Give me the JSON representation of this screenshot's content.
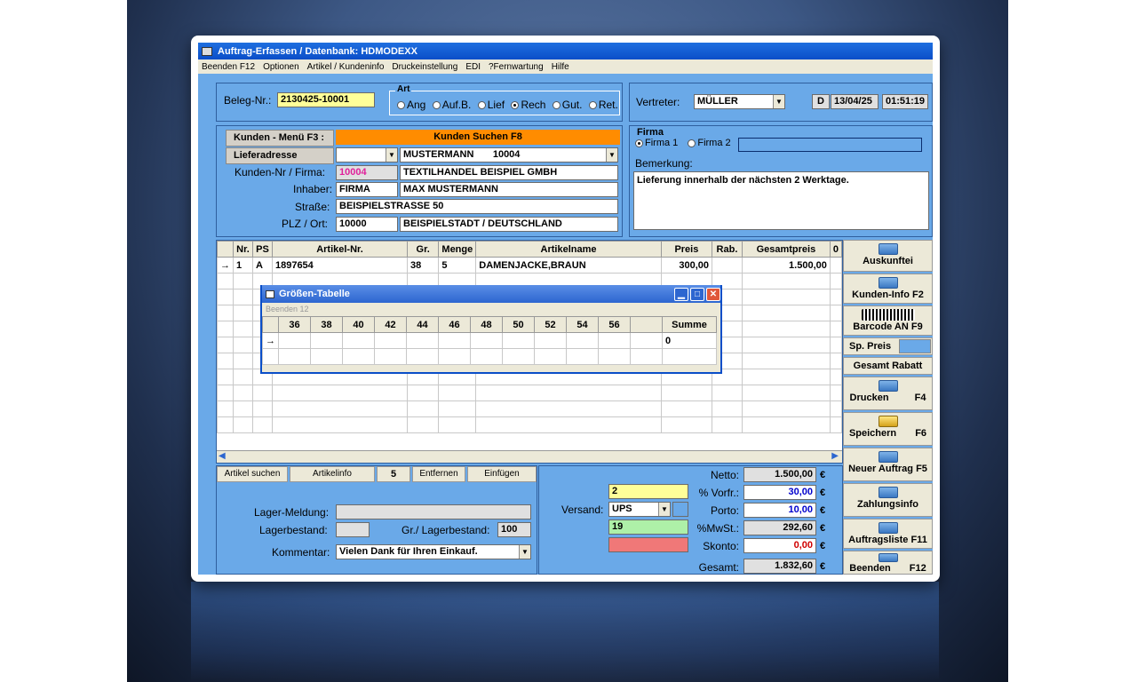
{
  "window": {
    "title": "Auftrag-Erfassen / Datenbank: HDMODEXX",
    "menu": [
      "Beenden F12",
      "Optionen",
      "Artikel / Kundeninfo",
      "Druckeinstellung",
      "EDI",
      "?Fernwartung",
      "Hilfe"
    ]
  },
  "header": {
    "beleg_label": "Beleg-Nr.:",
    "beleg_value": "2130425-10001",
    "art_label": "Art",
    "art_options": [
      "Ang",
      "Auf.B.",
      "Lief",
      "Rech",
      "Gut.",
      "Ret."
    ],
    "art_selected": "Rech",
    "vertreter_label": "Vertreter:",
    "vertreter_value": "MÜLLER",
    "d_button": "D",
    "date": "13/04/25",
    "time": "01:51:19"
  },
  "customer": {
    "menu_label": "Kunden - Menü  F3 :",
    "search_label": "Kunden Suchen      F8",
    "lieferadresse_label": "Lieferadresse",
    "customer_select": "MUSTERMANN       10004",
    "kundennr_label": "Kunden-Nr / Firma:",
    "kundennr_value": "10004",
    "firma_value": "TEXTILHANDEL BEISPIEL GMBH",
    "inhaber_label": "Inhaber:",
    "inhaber_value1": "FIRMA",
    "inhaber_value2": "MAX MUSTERMANN",
    "strasse_label": "Straße:",
    "strasse_value": "BEISPIELSTRASSE 50",
    "plz_label": "PLZ / Ort:",
    "plz_value": "10000",
    "ort_value": "BEISPIELSTADT / DEUTSCHLAND"
  },
  "firma": {
    "label": "Firma",
    "option1": "Firma 1",
    "option2": "Firma 2",
    "bemerkung_label": "Bemerkung:",
    "bemerkung_value": "Lieferung innerhalb der nächsten 2 Werktage."
  },
  "grid": {
    "columns": [
      "Nr.",
      "PS",
      "Artikel-Nr.",
      "Gr.",
      "Menge",
      "Artikelname",
      "Preis",
      "Rab.",
      "Gesamtpreis",
      "0"
    ],
    "rows": [
      [
        "1",
        "A",
        "1897654",
        "38",
        "5",
        "DAMENJACKE,BRAUN",
        "300,00",
        "",
        "1.500,00",
        ""
      ]
    ],
    "row_marker": "→"
  },
  "popup": {
    "title": "Größen-Tabelle",
    "menu": "Beenden 12",
    "columns": [
      "36",
      "38",
      "40",
      "42",
      "44",
      "46",
      "48",
      "50",
      "52",
      "54",
      "56",
      "",
      "Summe"
    ],
    "sum_value": "0",
    "row_marker": "→"
  },
  "side_buttons": {
    "auskunft": "Auskunftei",
    "kundeninfo": "Kunden-Info F2",
    "barcode": "Barcode AN F9",
    "sp_preis": "Sp. Preis",
    "gesamt_rabatt": "Gesamt Rabatt",
    "drucken": "Drucken",
    "drucken_key": "F4",
    "speichern": "Speichern",
    "speichern_key": "F6",
    "neuer_auftrag": "Neuer Auftrag F5",
    "zahlungsinfo": "Zahlungsinfo",
    "auftragsliste": "Auftragsliste F11",
    "beenden": "Beenden",
    "beenden_key": "F12"
  },
  "bottom_tabs": [
    "Artikel suchen",
    "Artikelinfo",
    "5",
    "Entfernen",
    "Einfügen"
  ],
  "stock": {
    "lager_meldung_label": "Lager-Meldung:",
    "lagerbestand_label": "Lagerbestand:",
    "gr_lagerbestand_label": "Gr./ Lagerbestand:",
    "gr_lagerbestand_value": "100",
    "kommentar_label": "Kommentar:",
    "kommentar_value": "Vielen Dank für Ihren Einkauf."
  },
  "totals": {
    "versand_label": "Versand:",
    "versand_value": "UPS",
    "vorfr_value": "2",
    "mwst_value": "19",
    "netto_label": "Netto:",
    "netto": "1.500,00",
    "vorfr_label": "% Vorfr.:",
    "vorfr": "30,00",
    "porto_label": "Porto:",
    "porto": "10,00",
    "mwst_label": "%MwSt.:",
    "mwst": "292,60",
    "skonto_label": "Skonto:",
    "skonto": "0,00",
    "gesamt_label": "Gesamt:",
    "gesamt": "1.832,60",
    "currency": "€"
  },
  "colors": {
    "title_blue": "#0a4ec8",
    "panel_blue": "#6aa9e8",
    "orange": "#ff8c00",
    "yellow": "#ffff99",
    "green": "#aef0a8",
    "red": "#f07878",
    "netto_blue": "#0000cc",
    "skonto_red": "#d00000"
  }
}
